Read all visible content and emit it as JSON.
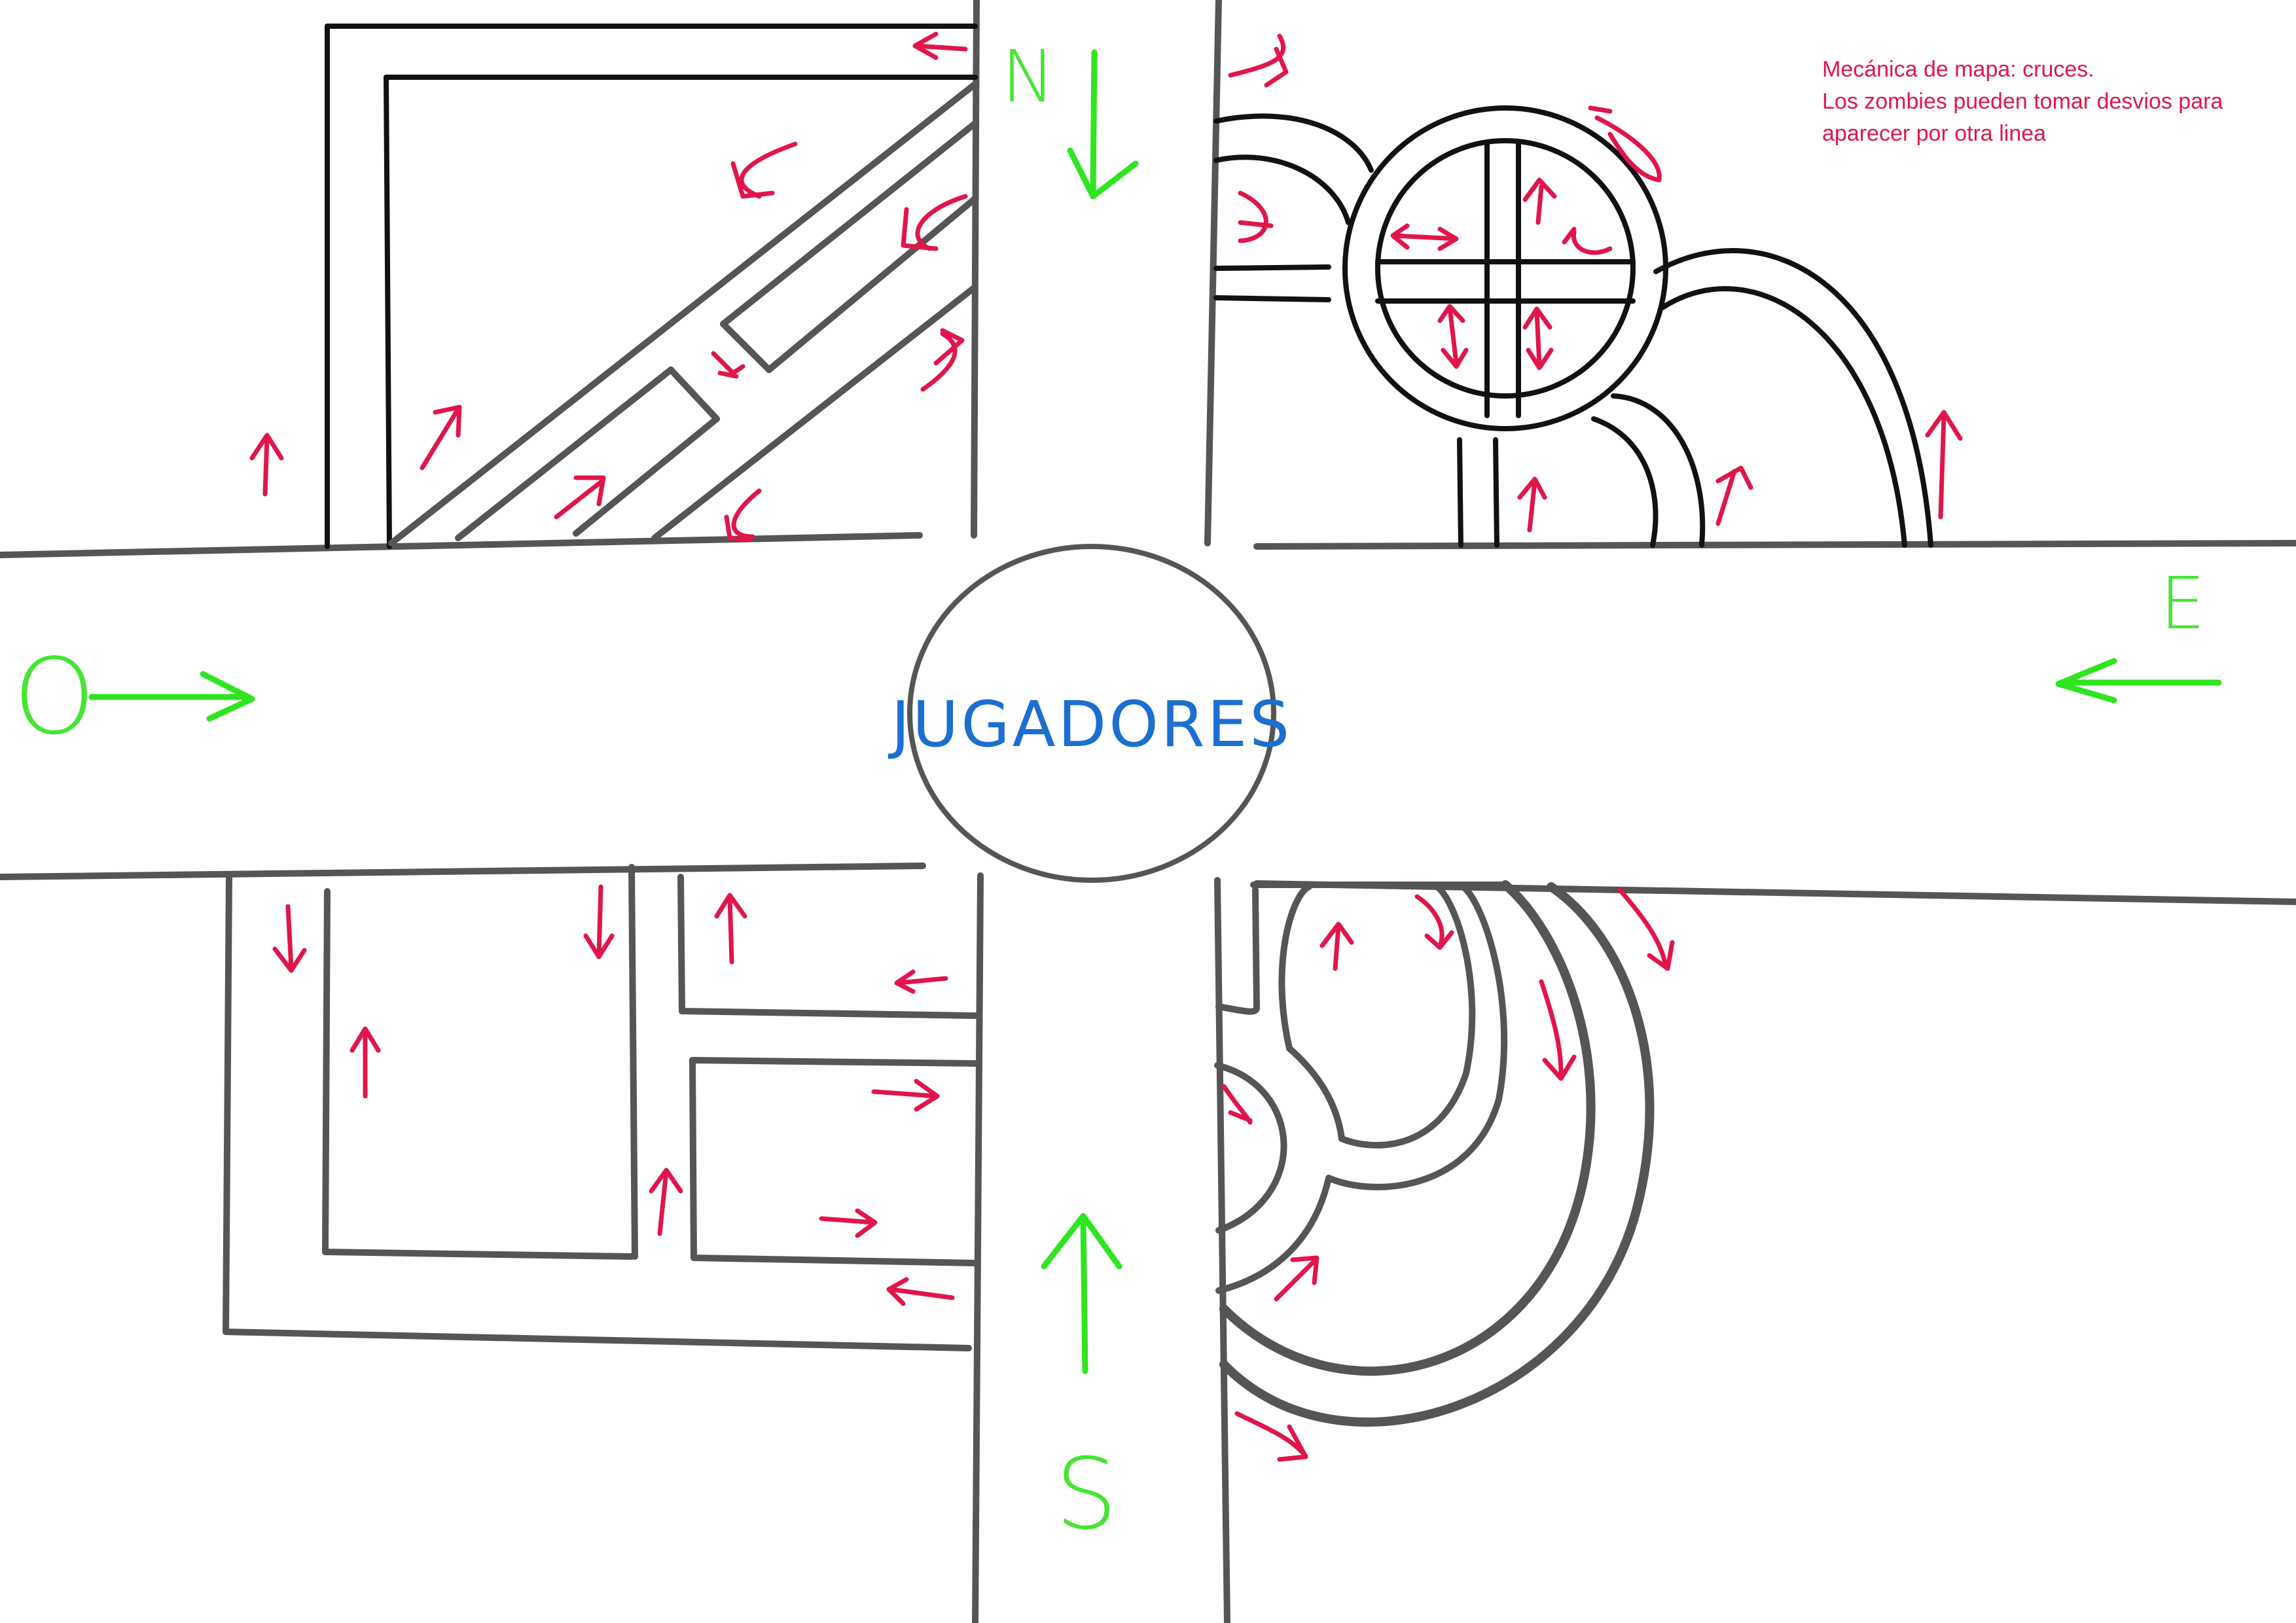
{
  "note": {
    "lines": [
      "Mecánica de mapa: cruces.",
      "Los zombies pueden tomar desvios para",
      "aparecer por otra linea"
    ]
  },
  "center": {
    "label": "JUGADORES"
  },
  "directions": {
    "north": "N",
    "south": "S",
    "east": "E",
    "west": "O"
  },
  "colors": {
    "note": "#e0164a",
    "zombie_arrows": "#e0164a",
    "spawn_arrows": "#2ee51f",
    "center_label": "#1b6fd0",
    "roads": "#555555"
  }
}
